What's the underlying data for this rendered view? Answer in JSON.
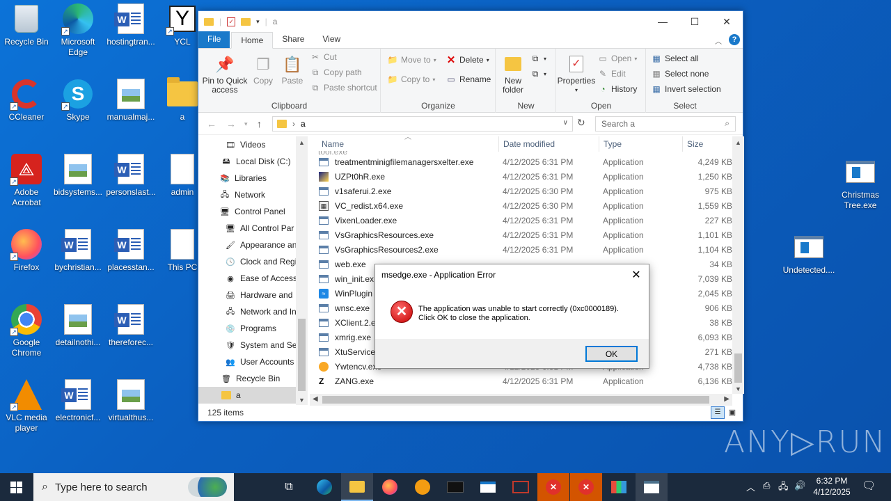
{
  "desktop": {
    "icons": [
      {
        "label": "Recycle Bin",
        "icon": "recycle-bin-icon"
      },
      {
        "label": "Microsoft Edge",
        "icon": "edge-icon"
      },
      {
        "label": "hostingtran...",
        "icon": "word-doc-icon"
      },
      {
        "label": "YCL",
        "icon": "ycl-icon"
      },
      {
        "label": "CCleaner",
        "icon": "ccleaner-icon"
      },
      {
        "label": "Skype",
        "icon": "skype-icon"
      },
      {
        "label": "manualmaj...",
        "icon": "image-doc-icon"
      },
      {
        "label": "a",
        "icon": "folder-icon"
      },
      {
        "label": "Adobe Acrobat",
        "icon": "acrobat-icon"
      },
      {
        "label": "bidsystems...",
        "icon": "image-doc-icon"
      },
      {
        "label": "personslast...",
        "icon": "word-doc-icon"
      },
      {
        "label": "admin",
        "icon": "blank-doc-icon"
      },
      {
        "label": "Firefox",
        "icon": "firefox-icon"
      },
      {
        "label": "bychristian...",
        "icon": "word-doc-icon"
      },
      {
        "label": "placesstan...",
        "icon": "word-doc-icon"
      },
      {
        "label": "This PC",
        "icon": "blank-doc-icon"
      },
      {
        "label": "Google Chrome",
        "icon": "chrome-icon"
      },
      {
        "label": "detailnothi...",
        "icon": "image-doc-icon"
      },
      {
        "label": "thereforec...",
        "icon": "word-doc-icon"
      },
      {
        "label": "VLC media player",
        "icon": "vlc-icon"
      },
      {
        "label": "electronicf...",
        "icon": "word-doc-icon"
      },
      {
        "label": "virtualthus...",
        "icon": "image-doc-icon"
      },
      {
        "label": "Christmas Tree.exe",
        "icon": "app-window-icon"
      },
      {
        "label": "Undetected....",
        "icon": "app-window-icon"
      }
    ]
  },
  "explorer": {
    "title": "a",
    "window_controls": {
      "minimize": "—",
      "maximize": "☐",
      "close": "✕"
    },
    "tabs": [
      "File",
      "Home",
      "Share",
      "View"
    ],
    "ribbon": {
      "clipboard": {
        "group": "Clipboard",
        "pin": "Pin to Quick access",
        "copy": "Copy",
        "paste": "Paste",
        "cut": "Cut",
        "copy_path": "Copy path",
        "paste_shortcut": "Paste shortcut"
      },
      "organize": {
        "group": "Organize",
        "move_to": "Move to",
        "copy_to": "Copy to",
        "delete": "Delete",
        "rename": "Rename"
      },
      "new": {
        "group": "New",
        "new_folder": "New folder"
      },
      "open": {
        "group": "Open",
        "properties": "Properties",
        "open": "Open",
        "edit": "Edit",
        "history": "History"
      },
      "select": {
        "group": "Select",
        "select_all": "Select all",
        "select_none": "Select none",
        "invert": "Invert selection"
      }
    },
    "address": {
      "path": "a",
      "search_placeholder": "Search a"
    },
    "nav_items": [
      "Videos",
      "Local Disk (C:)",
      "Libraries",
      "Network",
      "Control Panel",
      "All Control Par",
      "Appearance an",
      "Clock and Regi",
      "Ease of Access",
      "Hardware and",
      "Network and In",
      "Programs",
      "System and Sec",
      "User Accounts",
      "Recycle Bin",
      "a"
    ],
    "columns": {
      "name": "Name",
      "date": "Date modified",
      "type": "Type",
      "size": "Size"
    },
    "files": [
      {
        "name": "treatmentminigfilemanagersxelter.exe",
        "date": "4/12/2025 6:31 PM",
        "type": "Application",
        "size": "4,249 KB"
      },
      {
        "name": "UZPt0hR.exe",
        "date": "4/12/2025 6:31 PM",
        "type": "Application",
        "size": "1,250 KB"
      },
      {
        "name": "v1saferui.2.exe",
        "date": "4/12/2025 6:30 PM",
        "type": "Application",
        "size": "975 KB"
      },
      {
        "name": "VC_redist.x64.exe",
        "date": "4/12/2025 6:30 PM",
        "type": "Application",
        "size": "1,559 KB"
      },
      {
        "name": "VixenLoader.exe",
        "date": "4/12/2025 6:31 PM",
        "type": "Application",
        "size": "227 KB"
      },
      {
        "name": "VsGraphicsResources.exe",
        "date": "4/12/2025 6:31 PM",
        "type": "Application",
        "size": "1,101 KB"
      },
      {
        "name": "VsGraphicsResources2.exe",
        "date": "4/12/2025 6:31 PM",
        "type": "Application",
        "size": "1,104 KB"
      },
      {
        "name": "web.exe",
        "date": "",
        "type": "",
        "size": "34 KB"
      },
      {
        "name": "win_init.ex",
        "date": "",
        "type": "",
        "size": "7,039 KB"
      },
      {
        "name": "WinPlugin",
        "date": "",
        "type": "",
        "size": "2,045 KB"
      },
      {
        "name": "wnsc.exe",
        "date": "",
        "type": "",
        "size": "906 KB"
      },
      {
        "name": "XClient.2.e",
        "date": "",
        "type": "",
        "size": "38 KB"
      },
      {
        "name": "xmrig.exe",
        "date": "",
        "type": "",
        "size": "6,093 KB"
      },
      {
        "name": "XtuService",
        "date": "",
        "type": "",
        "size": "271 KB"
      },
      {
        "name": "Ywtencv.exe",
        "date": "4/12/2025 6:31 PM",
        "type": "Application",
        "size": "4,738 KB"
      },
      {
        "name": "ZANG.exe",
        "date": "4/12/2025 6:31 PM",
        "type": "Application",
        "size": "6,136 KB"
      }
    ],
    "status": "125 items"
  },
  "dialog": {
    "title": "msedge.exe - Application Error",
    "line1": "The application was unable to start correctly (0xc0000189).",
    "line2": "Click OK to close the application.",
    "ok": "OK"
  },
  "watermark": "ANY▷RUN",
  "taskbar": {
    "search_placeholder": "Type here to search",
    "time": "6:32 PM",
    "date": "4/12/2025"
  }
}
